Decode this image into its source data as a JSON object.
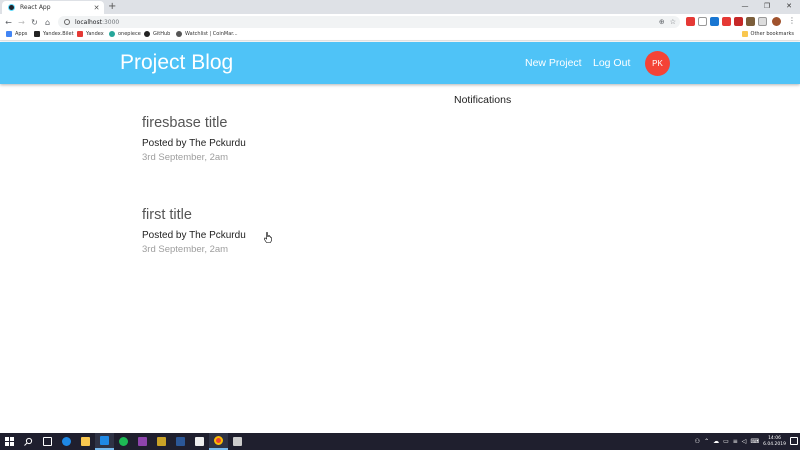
{
  "browser": {
    "tab": {
      "title": "React App",
      "favicon": "react-icon"
    },
    "toolbar": {
      "url_host": "localhost",
      "url_port": ":3000"
    },
    "bookmarks": [
      {
        "label": "Apps",
        "icon": "apps-grid-icon",
        "color": "#4285f4"
      },
      {
        "label": "Yandex.Bilet",
        "icon": "yandex-bilet-icon",
        "color": "#222222"
      },
      {
        "label": "Yandex",
        "icon": "yandex-icon",
        "color": "#e53935"
      },
      {
        "label": "onepiece",
        "icon": "onepiece-icon",
        "color": "#26a69a"
      },
      {
        "label": "GitHub",
        "icon": "github-icon",
        "color": "#222222"
      },
      {
        "label": "Watchlist | CoinMar...",
        "icon": "coinmarket-icon",
        "color": "#555555"
      }
    ],
    "other_bookmarks": "Other bookmarks"
  },
  "app": {
    "brand": "Project Blog",
    "nav": {
      "new_project": "New Project",
      "log_out": "Log Out"
    },
    "avatar_initials": "PK",
    "colors": {
      "navbar": "#4fc3f7",
      "avatar": "#f44336"
    }
  },
  "notifications": {
    "title": "Notifications"
  },
  "posts": [
    {
      "title": "firesbase title",
      "author": "Posted by The Pckurdu",
      "date": "3rd September, 2am"
    },
    {
      "title": "first title",
      "author": "Posted by The Pckurdu",
      "date": "3rd September, 2am"
    }
  ],
  "taskbar": {
    "time": "14:06",
    "date": "6.04.2019"
  }
}
